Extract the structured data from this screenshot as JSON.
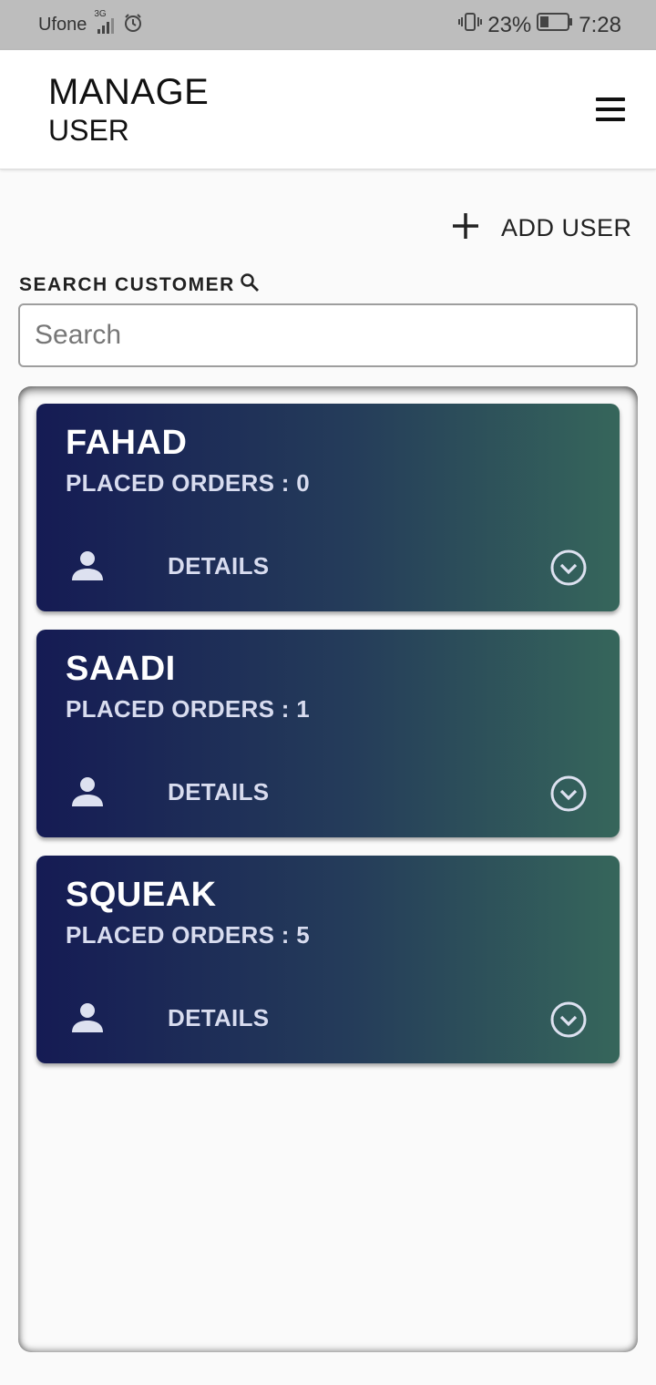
{
  "status_bar": {
    "carrier": "Ufone",
    "network": "3G",
    "battery": "23%",
    "time": "7:28"
  },
  "app_bar": {
    "title_main": "MANAGE",
    "title_sub": "USER"
  },
  "actions": {
    "add_user_label": "ADD USER"
  },
  "search": {
    "label": "SEARCH CUSTOMER",
    "placeholder": "Search",
    "value": ""
  },
  "users": [
    {
      "name": "FAHAD",
      "orders_text": "PLACED ORDERS : 0",
      "details_label": "DETAILS"
    },
    {
      "name": "SAADI",
      "orders_text": "PLACED ORDERS : 1",
      "details_label": "DETAILS"
    },
    {
      "name": "SQUEAK",
      "orders_text": "PLACED ORDERS : 5",
      "details_label": "DETAILS"
    }
  ],
  "colors": {
    "card_gradient_start": "#151b54",
    "card_gradient_end": "#36665b",
    "status_bar_bg": "#bdbdbd"
  }
}
